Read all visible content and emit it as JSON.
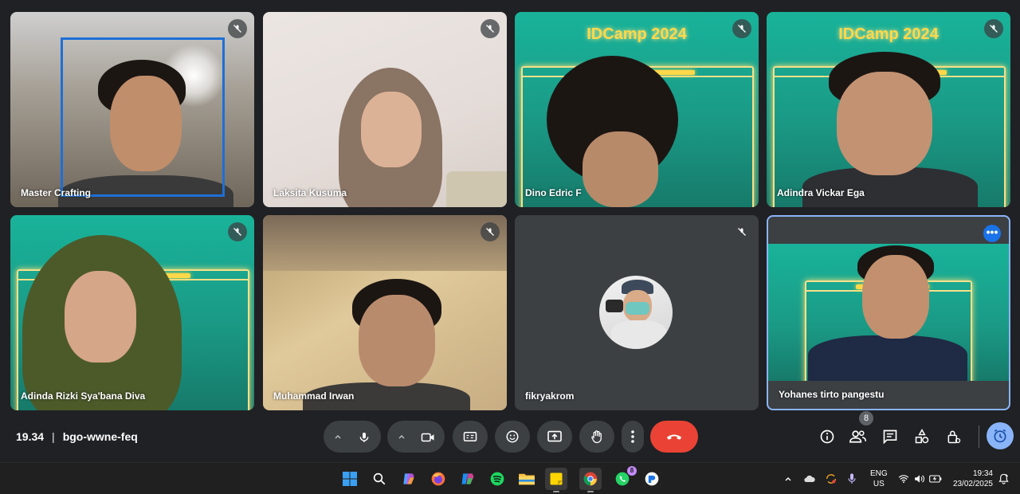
{
  "participants": [
    {
      "name": "Master Crafting",
      "muted": true
    },
    {
      "name": "Laksita Kusuma",
      "muted": true
    },
    {
      "name": "Dino Edric F",
      "muted": true,
      "background_text": "IDCamp 2024"
    },
    {
      "name": "Adindra Vickar Ega",
      "muted": true,
      "background_text": "IDCamp 2024"
    },
    {
      "name": "Adinda Rizki Sya'bana Diva",
      "muted": true
    },
    {
      "name": "Muhammad Irwan",
      "muted": true
    },
    {
      "name": "fikryakrom",
      "muted": true
    },
    {
      "name": "Yohanes tirto pangestu",
      "muted": false
    }
  ],
  "meeting": {
    "time": "19.34",
    "code": "bgo-wwne-feq"
  },
  "controls": {
    "people_count": "8",
    "icons": [
      "mic-icon",
      "camera-icon",
      "captions-icon",
      "emoji-icon",
      "present-icon",
      "raise-hand-icon",
      "more-options-icon",
      "end-call-icon"
    ]
  },
  "taskbar": {
    "language": "ENG",
    "region": "US",
    "time": "19:34",
    "date": "23/02/2025",
    "whatsapp_badge": "8"
  },
  "colors": {
    "meet_bg": "#202124",
    "tile_bg": "#3c4043",
    "end_call": "#ea4335",
    "accent": "#8ab4f8",
    "idcamp_green": "#1a9a86"
  }
}
